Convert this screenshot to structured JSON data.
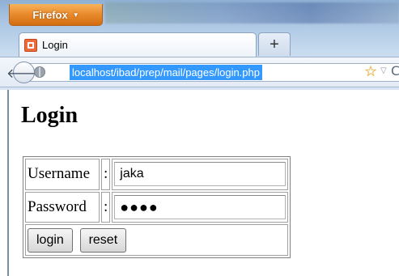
{
  "browser": {
    "app_button_label": "Firefox",
    "tab_title": "Login",
    "new_tab_label": "+",
    "url": "localhost/ibad/prep/mail/pages/login.php",
    "accent_color": "#e8892a",
    "selection_color": "#3399ff"
  },
  "page": {
    "title": "Login",
    "form": {
      "username_label": "Username",
      "password_label": "Password",
      "separator": ":",
      "username_value": "jaka",
      "password_mask": "●●●●",
      "login_button": "login",
      "reset_button": "reset"
    }
  },
  "icons": [
    "firefox-menu-caret-icon",
    "tab-favicon",
    "back-arrow-icon",
    "globe-icon",
    "bookmark-star-icon",
    "dropdown-icon",
    "reload-icon"
  ]
}
